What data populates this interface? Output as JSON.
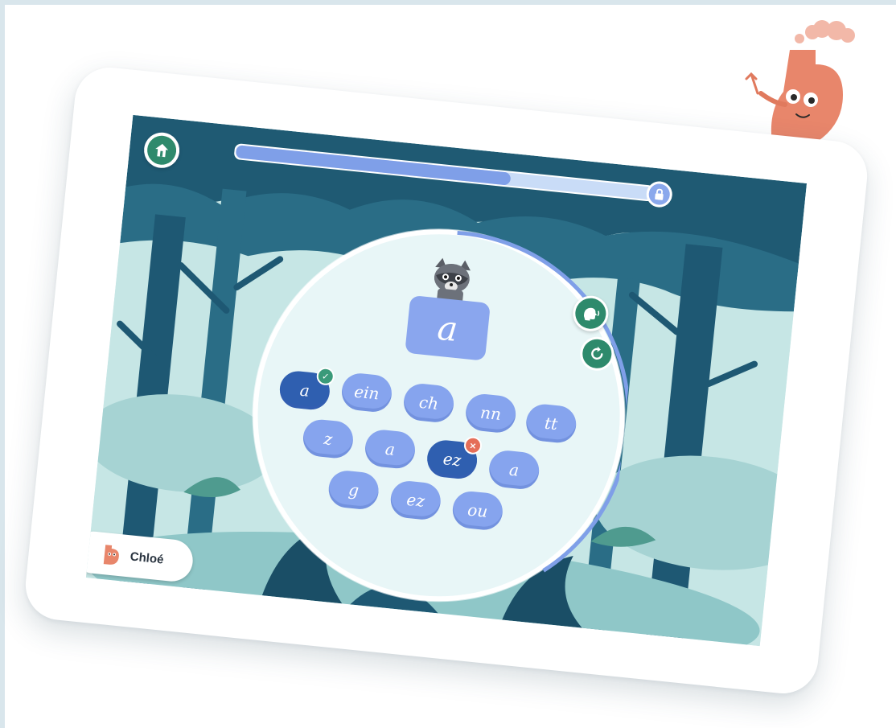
{
  "colors": {
    "accent_green": "#2e8a6c",
    "chip_blue": "#86a4ee",
    "chip_selected": "#2f5fb0",
    "correct": "#3a9a7a",
    "wrong": "#e56e58",
    "mascot": "#e8866b"
  },
  "progress": {
    "fraction": 0.66,
    "locked": true
  },
  "prompt": {
    "grapheme": "a"
  },
  "choices": [
    {
      "label": "a",
      "state": "correct"
    },
    {
      "label": "ein",
      "state": "idle"
    },
    {
      "label": "ch",
      "state": "idle"
    },
    {
      "label": "nn",
      "state": "idle"
    },
    {
      "label": "tt",
      "state": "idle"
    },
    {
      "label": "z",
      "state": "idle"
    },
    {
      "label": "a",
      "state": "idle"
    },
    {
      "label": "ez",
      "state": "wrong"
    },
    {
      "label": "a",
      "state": "idle"
    },
    {
      "label": "g",
      "state": "idle"
    },
    {
      "label": "ez",
      "state": "idle"
    },
    {
      "label": "ou",
      "state": "idle"
    }
  ],
  "player": {
    "name": "Chloé"
  },
  "icons": {
    "home": "home-icon",
    "lock": "lock-icon",
    "sound": "speaker-head-icon",
    "replay": "replay-icon",
    "avatar": "orange-creature-avatar"
  }
}
